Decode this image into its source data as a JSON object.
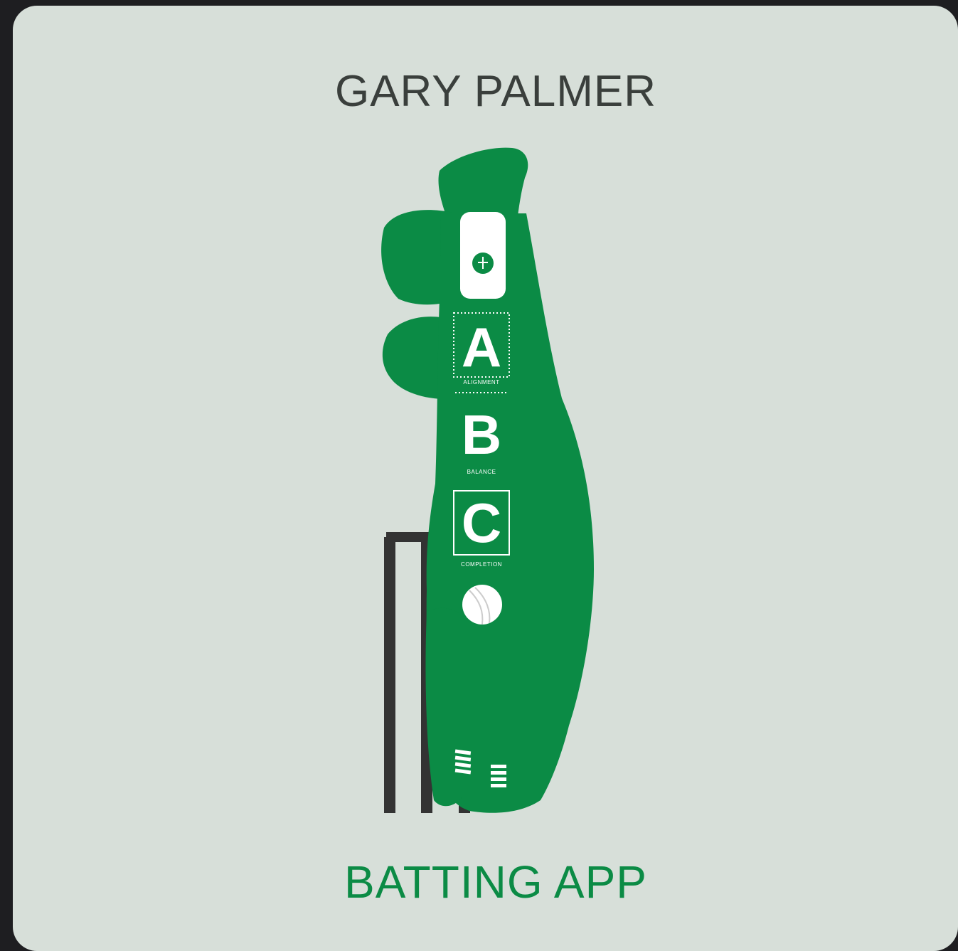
{
  "logo": {
    "title": "GARY PALMER",
    "subtitle": "BATTING APP",
    "letters": [
      "A",
      "B",
      "C"
    ],
    "captions": [
      "ALIGNMENT",
      "BALANCE",
      "COMPLETION"
    ],
    "colors": {
      "background": "#d7dfd9",
      "frame": "#1e1e21",
      "accent": "#0b8b45",
      "title": "#3a3f3c",
      "stumps": "#333333"
    },
    "icons": [
      "cricketer-silhouette",
      "bat",
      "stumps",
      "cricket-ball"
    ]
  }
}
